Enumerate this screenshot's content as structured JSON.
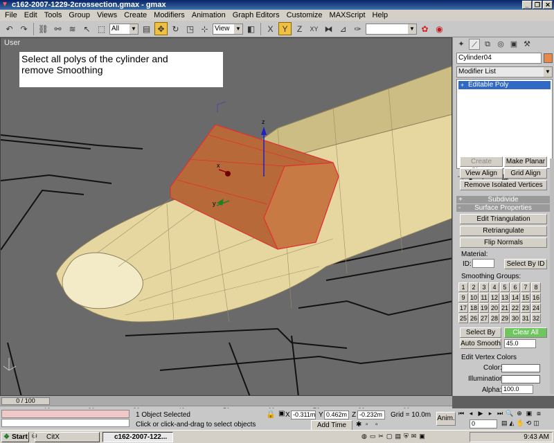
{
  "window": {
    "title": "c162-2007-1229-2crossection.gmax - gmax"
  },
  "menu": [
    "File",
    "Edit",
    "Tools",
    "Group",
    "Views",
    "Create",
    "Modifiers",
    "Animation",
    "Graph Editors",
    "Customize",
    "MAXScript",
    "Help"
  ],
  "toolbar": {
    "selection_filter": "All",
    "ref_coord": "View"
  },
  "viewport": {
    "label": "User",
    "instruction_line1": "Select all polys of the cylinder and",
    "instruction_line2": "remove Smoothing"
  },
  "command_panel": {
    "object_name": "Cylinder04",
    "object_color": "#e8884a",
    "modifier_list": "Modifier List",
    "stack_item": "Editable Poly",
    "buttons": {
      "create_shape": "Create Shape",
      "make_planar": "Make Planar",
      "view_align": "View Align",
      "grid_align": "Grid Align",
      "remove_isolated": "Remove Isolated Vertices",
      "edit_triangulation": "Edit Triangulation",
      "retriangulate": "Retriangulate",
      "flip_normals": "Flip Normals",
      "select_by_id": "Select By ID",
      "select_by_sg": "Select By SG",
      "clear_all": "Clear All"
    },
    "rollouts": {
      "subdivide": "Subdivide",
      "surface_properties": "Surface Properties"
    },
    "labels": {
      "material": "Material:",
      "id": "ID:",
      "smoothing_groups": "Smoothing Groups:",
      "auto_smooth": "Auto Smooth",
      "auto_smooth_value": "45.0",
      "edit_vertex_colors": "Edit Vertex Colors",
      "color": "Color:",
      "illumination": "Illumination:",
      "alpha": "Alpha:",
      "alpha_value": "100.0"
    },
    "smoothing_groups": [
      "1",
      "2",
      "3",
      "4",
      "5",
      "6",
      "7",
      "8",
      "9",
      "10",
      "11",
      "12",
      "13",
      "14",
      "15",
      "16",
      "17",
      "18",
      "19",
      "20",
      "21",
      "22",
      "23",
      "24",
      "25",
      "26",
      "27",
      "28",
      "29",
      "30",
      "31",
      "32"
    ]
  },
  "timeline": {
    "frame": "0 / 100",
    "ticks": [
      "10",
      "20",
      "30",
      "40",
      "50",
      "60",
      "70",
      "80",
      "90"
    ]
  },
  "status": {
    "selected": "1 Object Selected",
    "prompt": "Click or click-and-drag to select objects",
    "x_value": "-0.311m",
    "y_value": "0.462m",
    "z_value": "-0.232m",
    "grid": "Grid = 10.0m",
    "add_time_tag": "Add Time Tag",
    "anim": "Anim.",
    "frame_field": "0"
  },
  "taskbar": {
    "start": "Start",
    "tasks": [
      "CitX",
      "c162-2007-122..."
    ],
    "clock": "9:43 AM"
  }
}
